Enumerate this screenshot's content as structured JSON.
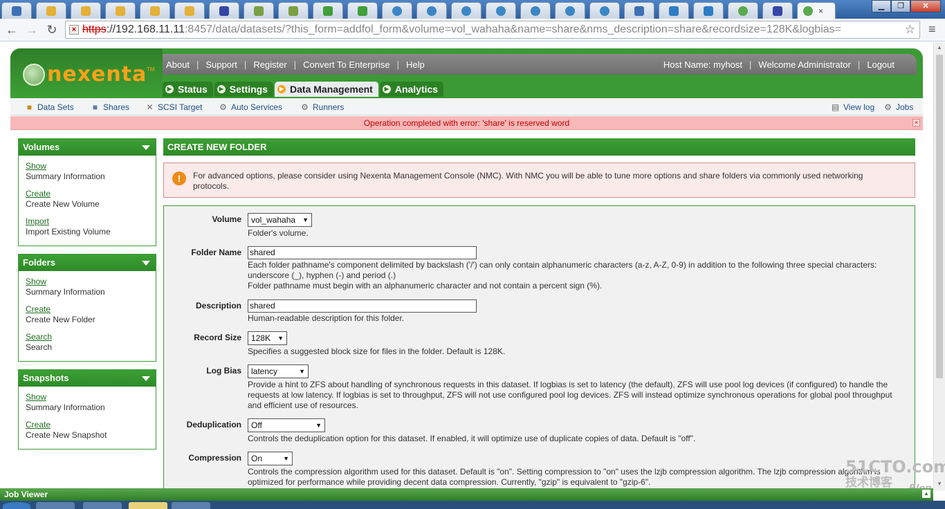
{
  "browser": {
    "tab_close": "×",
    "url_scheme": "https",
    "url_host": "://192.168.11.11",
    "url_rest": ":8457/data/datasets/?this_form=addfol_form&volume=vol_wahaha&name=share&nms_description=share&recordsize=128K&logbias=",
    "back": "←",
    "forward": "→",
    "reload": "↻",
    "star": "☆",
    "menu": "≡",
    "min": "▁",
    "max": "❐",
    "close": "✕"
  },
  "app": {
    "logo": "nexenta",
    "logo_tm": "TM",
    "top_links": [
      "About",
      "Support",
      "Register",
      "Convert To Enterprise",
      "Help"
    ],
    "host_name": "Host Name: myhost",
    "welcome": "Welcome Administrator",
    "logout": "Logout",
    "tabs": [
      "Status",
      "Settings",
      "Data Management",
      "Analytics"
    ],
    "subnav": {
      "data_sets": "Data Sets",
      "shares": "Shares",
      "scsi": "SCSI Target",
      "auto": "Auto Services",
      "runners": "Runners",
      "view_log": "View log",
      "jobs": "Jobs"
    },
    "error": "Operation completed with error: 'share' is reserved word",
    "error_close": "×"
  },
  "sidebar": {
    "volumes": {
      "title": "Volumes",
      "items": [
        {
          "link": "Show",
          "desc": "Summary Information"
        },
        {
          "link": "Create",
          "desc": "Create New Volume"
        },
        {
          "link": "Import",
          "desc": "Import Existing Volume"
        }
      ]
    },
    "folders": {
      "title": "Folders",
      "items": [
        {
          "link": "Show",
          "desc": "Summary Information"
        },
        {
          "link": "Create",
          "desc": "Create New Folder"
        },
        {
          "link": "Search",
          "desc": "Search"
        }
      ]
    },
    "snapshots": {
      "title": "Snapshots",
      "items": [
        {
          "link": "Show",
          "desc": "Summary Information"
        },
        {
          "link": "Create",
          "desc": "Create New Snapshot"
        }
      ]
    }
  },
  "main": {
    "title": "CREATE NEW FOLDER",
    "notice": "For advanced options, please consider using Nexenta Management Console (NMC). With NMC you will be able to tune more options and share folders via commonly used networking protocols.",
    "warn_icon": "!",
    "form": {
      "volume": {
        "label": "Volume",
        "value": "vol_wahaha",
        "help": "Folder's volume."
      },
      "folder_name": {
        "label": "Folder Name",
        "value": "shared",
        "help": "Each folder pathname's component delimited by backslash ('/') can only contain alphanumeric characters (a-z, A-Z, 0-9) in addition to the following three special characters: underscore (_), hyphen (-) and period (.)",
        "help2": "Folder pathname must begin with an alphanumeric character and not contain a percent sign (%)."
      },
      "description": {
        "label": "Description",
        "value": "shared",
        "help": "Human-readable description for this folder."
      },
      "record_size": {
        "label": "Record Size",
        "value": "128K",
        "help": "Specifies a suggested block size for files in the folder. Default is 128K."
      },
      "log_bias": {
        "label": "Log Bias",
        "value": "latency",
        "help": "Provide a hint to ZFS about handling of synchronous requests in this dataset. If logbias is set to latency (the default), ZFS will use pool log devices (if configured) to handle the requests at low latency. If logbias is set to throughput, ZFS will not use configured pool log devices. ZFS will instead optimize synchronous operations for global pool throughput and efficient use of resources."
      },
      "dedup": {
        "label": "Deduplication",
        "value": "Off",
        "help": "Controls the deduplication option for this dataset. If enabled, it will optimize use of duplicate copies of data. Default is \"off\"."
      },
      "compression": {
        "label": "Compression",
        "value": "On",
        "help": "Controls the compression algorithm used for this dataset. Default is \"on\". Setting compression to \"on\" uses the lzjb compression algorithm. The lzjb compression algorithm is optimized for performance while providing decent data compression. Currently, \"gzip\" is equivalent to \"gzip-6\"."
      }
    }
  },
  "job_viewer": "Job Viewer",
  "watermark": {
    "line1": "51CTO.com",
    "line2": "技术博客",
    "blog": "Blog"
  }
}
